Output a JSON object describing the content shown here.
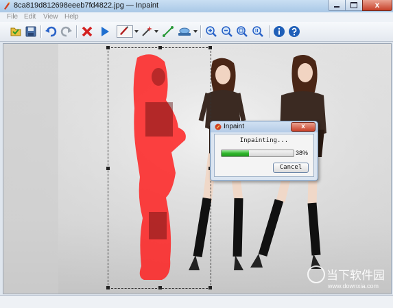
{
  "window": {
    "title": "8ca819d812698eeeb7fd4822.jpg — Inpaint",
    "close_label": "x"
  },
  "menu": {
    "items": [
      "File",
      "Edit",
      "View",
      "Help"
    ]
  },
  "toolbar": {
    "tools": [
      "open-icon",
      "save-icon",
      "undo-icon",
      "redo-icon",
      "delete-icon",
      "run-icon",
      "marker-icon",
      "magic-wand-icon",
      "line-icon",
      "stamp-icon",
      "zoom-in-icon",
      "zoom-out-icon",
      "zoom-fit-icon",
      "zoom-actual-icon",
      "info-icon",
      "help-icon"
    ],
    "selected_tool": "marker-icon"
  },
  "dialog": {
    "title": "Inpaint",
    "close_label": "x",
    "message": "Inpainting...",
    "progress": 38,
    "progress_label": "38%",
    "cancel_label": "Cancel"
  },
  "watermark": {
    "text": "当下软件园",
    "url": "www.downxia.com"
  },
  "colors": {
    "mask": "#ff2020",
    "accent": "#1f6fd0",
    "progress": "#2fb52c"
  }
}
